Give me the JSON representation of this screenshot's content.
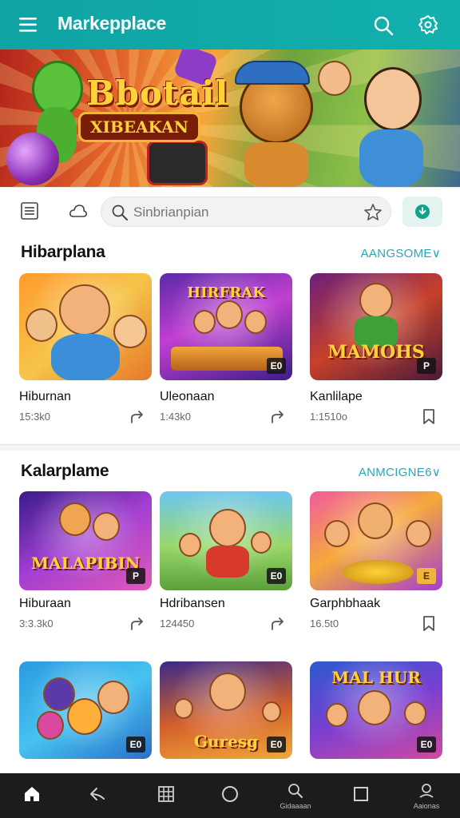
{
  "appbar": {
    "title": "Markepplace"
  },
  "banner": {
    "logo_line1": "Bbotail",
    "logo_line2": "XIBEAKAN"
  },
  "search": {
    "placeholder": "Sinbrianpian"
  },
  "sections": [
    {
      "title": "Hibarplana",
      "link": "AANGSOME∨",
      "cards": [
        {
          "name": "Hiburnan",
          "meta": "15:3k0",
          "thumb_title": "",
          "tag": "",
          "action_icon": "share-icon"
        },
        {
          "name": "Uleonaan",
          "meta": "1:43k0",
          "thumb_title": "HIRFRAK",
          "tag": "E0",
          "action_icon": "share-icon"
        },
        {
          "name": "Kanlilape",
          "meta": "1:1510o",
          "thumb_title": "MAMOHS",
          "tag": "P",
          "action_icon": "bookmark-icon"
        }
      ]
    },
    {
      "title": "Kalarplame",
      "link": "ANMCIGNE6∨",
      "cards": [
        {
          "name": "Hiburaan",
          "meta": "3:3.3k0",
          "thumb_title": "MALAPIBIN",
          "tag": "P",
          "action_icon": "share-icon"
        },
        {
          "name": "Hdribansen",
          "meta": "124450",
          "thumb_title": "",
          "tag": "E0",
          "action_icon": "share-icon"
        },
        {
          "name": "Garphbhaak",
          "meta": "16.5t0",
          "thumb_title": "",
          "tag": "E",
          "action_icon": "bookmark-icon"
        }
      ]
    },
    {
      "title": "",
      "link": "",
      "cards": [
        {
          "name": "",
          "meta": "",
          "thumb_title": "",
          "tag": "E0",
          "action_icon": ""
        },
        {
          "name": "",
          "meta": "",
          "thumb_title": "Guresg",
          "tag": "E0",
          "action_icon": ""
        },
        {
          "name": "",
          "meta": "",
          "thumb_title": "MAL HUR",
          "tag": "E0",
          "action_icon": ""
        }
      ]
    }
  ],
  "bottom_nav": [
    {
      "icon": "home-icon",
      "label": ""
    },
    {
      "icon": "back-icon",
      "label": ""
    },
    {
      "icon": "grid-icon",
      "label": ""
    },
    {
      "icon": "circle-icon",
      "label": ""
    },
    {
      "icon": "search-icon",
      "label": "Gidaaaan"
    },
    {
      "icon": "square-icon",
      "label": ""
    },
    {
      "icon": "profile-icon",
      "label": "Aaionas"
    }
  ],
  "colors": {
    "accent": "#12a9a8",
    "link": "#2ba4b8",
    "nav_bg": "#1c1c1c"
  }
}
